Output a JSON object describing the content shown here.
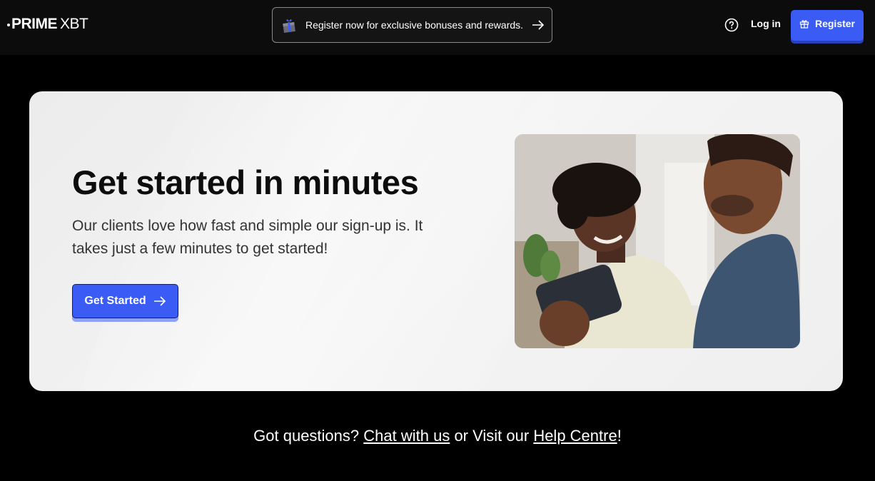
{
  "header": {
    "logo_prime": "PRIME",
    "logo_xbt": "XBT",
    "promo_text": "Register now for exclusive bonuses and rewards.",
    "login_label": "Log in",
    "register_label": "Register"
  },
  "hero": {
    "title": "Get started in minutes",
    "subtitle": "Our clients love how fast and simple our sign-up is. It takes just a few minutes to get started!",
    "cta_label": "Get Started"
  },
  "footer": {
    "prefix": "Got questions? ",
    "chat_link": "Chat with us",
    "middle": " or Visit our ",
    "help_link": "Help Centre",
    "suffix": "!"
  },
  "colors": {
    "accent": "#3a5cf5",
    "background": "#000000",
    "hero_bg": "#f0f0f0"
  },
  "icons": {
    "promo": "gift-box-icon",
    "promo_arrow": "arrow-right-icon",
    "help": "question-circle-icon",
    "register": "gift-icon",
    "cta_arrow": "arrow-right-icon"
  }
}
